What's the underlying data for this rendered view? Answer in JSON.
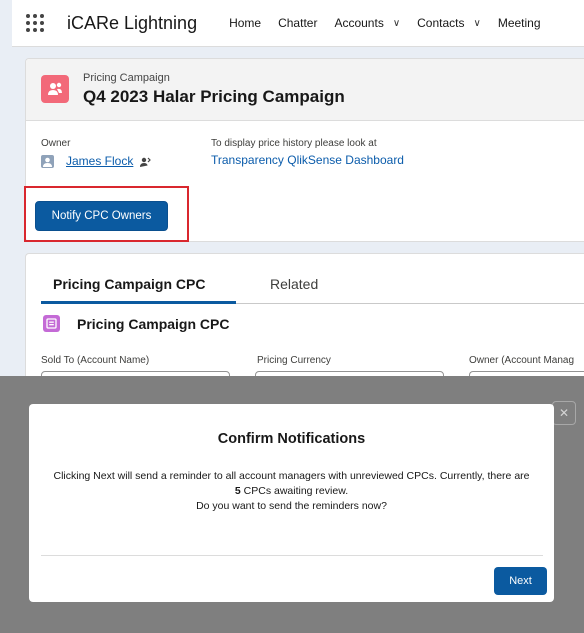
{
  "nav": {
    "app_name": "iCARe Lightning",
    "items": [
      {
        "label": "Home",
        "has_menu": false
      },
      {
        "label": "Chatter",
        "has_menu": false
      },
      {
        "label": "Accounts",
        "has_menu": true
      },
      {
        "label": "Contacts",
        "has_menu": true
      },
      {
        "label": "Meeting",
        "has_menu": false
      }
    ]
  },
  "record": {
    "object_type": "Pricing Campaign",
    "name": "Q4 2023 Halar Pricing Campaign",
    "owner_label": "Owner",
    "owner_name": "James Flock",
    "price_history_label": "To display price history please look at",
    "price_history_link": "Transparency QlikSense Dashboard",
    "notify_button": "Notify CPC Owners",
    "colors": {
      "object_icon": "#f26979",
      "brand": "#0b5aa0",
      "highlight": "#d9272e"
    }
  },
  "related": {
    "tabs": [
      {
        "label": "Pricing Campaign CPC",
        "active": true
      },
      {
        "label": "Related",
        "active": false
      }
    ],
    "list_title": "Pricing Campaign CPC",
    "filters": [
      {
        "label": "Sold To (Account Name)"
      },
      {
        "label": "Pricing Currency"
      },
      {
        "label": "Owner (Account Manag"
      }
    ]
  },
  "modal": {
    "close_glyph": "✕",
    "title": "Confirm Notifications",
    "body_pre": "Clicking Next will send a reminder to all account managers with unreviewed CPCs. Currently, there are ",
    "count": "5",
    "body_post": " CPCs awaiting review.",
    "question": "Do you want to send the reminders now?",
    "next_button": "Next"
  }
}
